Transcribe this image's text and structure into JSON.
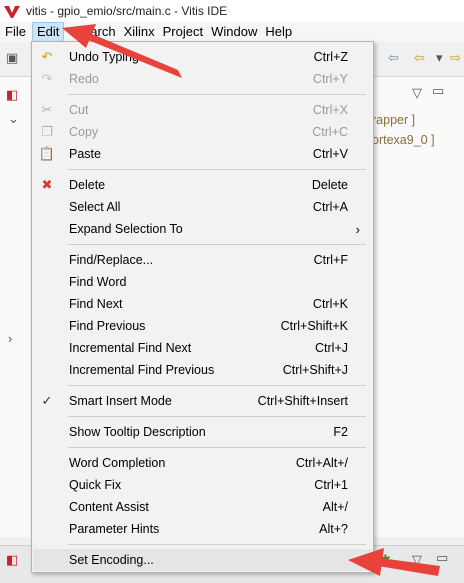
{
  "window": {
    "title": "vitis - gpio_emio/src/main.c - Vitis IDE"
  },
  "menubar": {
    "items": [
      {
        "label": "File"
      },
      {
        "label": "Edit"
      },
      {
        "label": "Search"
      },
      {
        "label": "Xilinx"
      },
      {
        "label": "Project"
      },
      {
        "label": "Window"
      },
      {
        "label": "Help"
      }
    ]
  },
  "background_panels": {
    "right_lines": [
      "rapper ]",
      "ortexa9_0 ]"
    ]
  },
  "edit_menu": {
    "items": [
      {
        "label": "Undo Typing",
        "accel": "Ctrl+Z",
        "icon": "undo-icon",
        "enabled": true
      },
      {
        "label": "Redo",
        "accel": "Ctrl+Y",
        "icon": "redo-icon",
        "enabled": false
      },
      {
        "label": "Cut",
        "accel": "Ctrl+X",
        "icon": "cut-icon",
        "enabled": false
      },
      {
        "label": "Copy",
        "accel": "Ctrl+C",
        "icon": "copy-icon",
        "enabled": false
      },
      {
        "label": "Paste",
        "accel": "Ctrl+V",
        "icon": "paste-icon",
        "enabled": true
      },
      {
        "label": "Delete",
        "accel": "Delete",
        "icon": "delete-icon",
        "enabled": true
      },
      {
        "label": "Select All",
        "accel": "Ctrl+A",
        "enabled": true
      },
      {
        "label": "Expand Selection To",
        "accel": "",
        "submenu": true,
        "enabled": true
      },
      {
        "label": "Find/Replace...",
        "accel": "Ctrl+F",
        "enabled": true
      },
      {
        "label": "Find Word",
        "accel": "",
        "enabled": true
      },
      {
        "label": "Find Next",
        "accel": "Ctrl+K",
        "enabled": true
      },
      {
        "label": "Find Previous",
        "accel": "Ctrl+Shift+K",
        "enabled": true
      },
      {
        "label": "Incremental Find Next",
        "accel": "Ctrl+J",
        "enabled": true
      },
      {
        "label": "Incremental Find Previous",
        "accel": "Ctrl+Shift+J",
        "enabled": true
      },
      {
        "label": "Smart Insert Mode",
        "accel": "Ctrl+Shift+Insert",
        "checked": true,
        "enabled": true
      },
      {
        "label": "Show Tooltip Description",
        "accel": "F2",
        "enabled": true
      },
      {
        "label": "Word Completion",
        "accel": "Ctrl+Alt+/",
        "enabled": true
      },
      {
        "label": "Quick Fix",
        "accel": "Ctrl+1",
        "enabled": true
      },
      {
        "label": "Content Assist",
        "accel": "Alt+/",
        "enabled": true
      },
      {
        "label": "Parameter Hints",
        "accel": "Alt+?",
        "enabled": true
      },
      {
        "label": "Set Encoding...",
        "accel": "",
        "enabled": true
      }
    ]
  },
  "colors": {
    "annotation_arrow": "#e8433b",
    "active_menu_bg": "#cce4f7",
    "menu_bg": "#f2f2f2"
  }
}
